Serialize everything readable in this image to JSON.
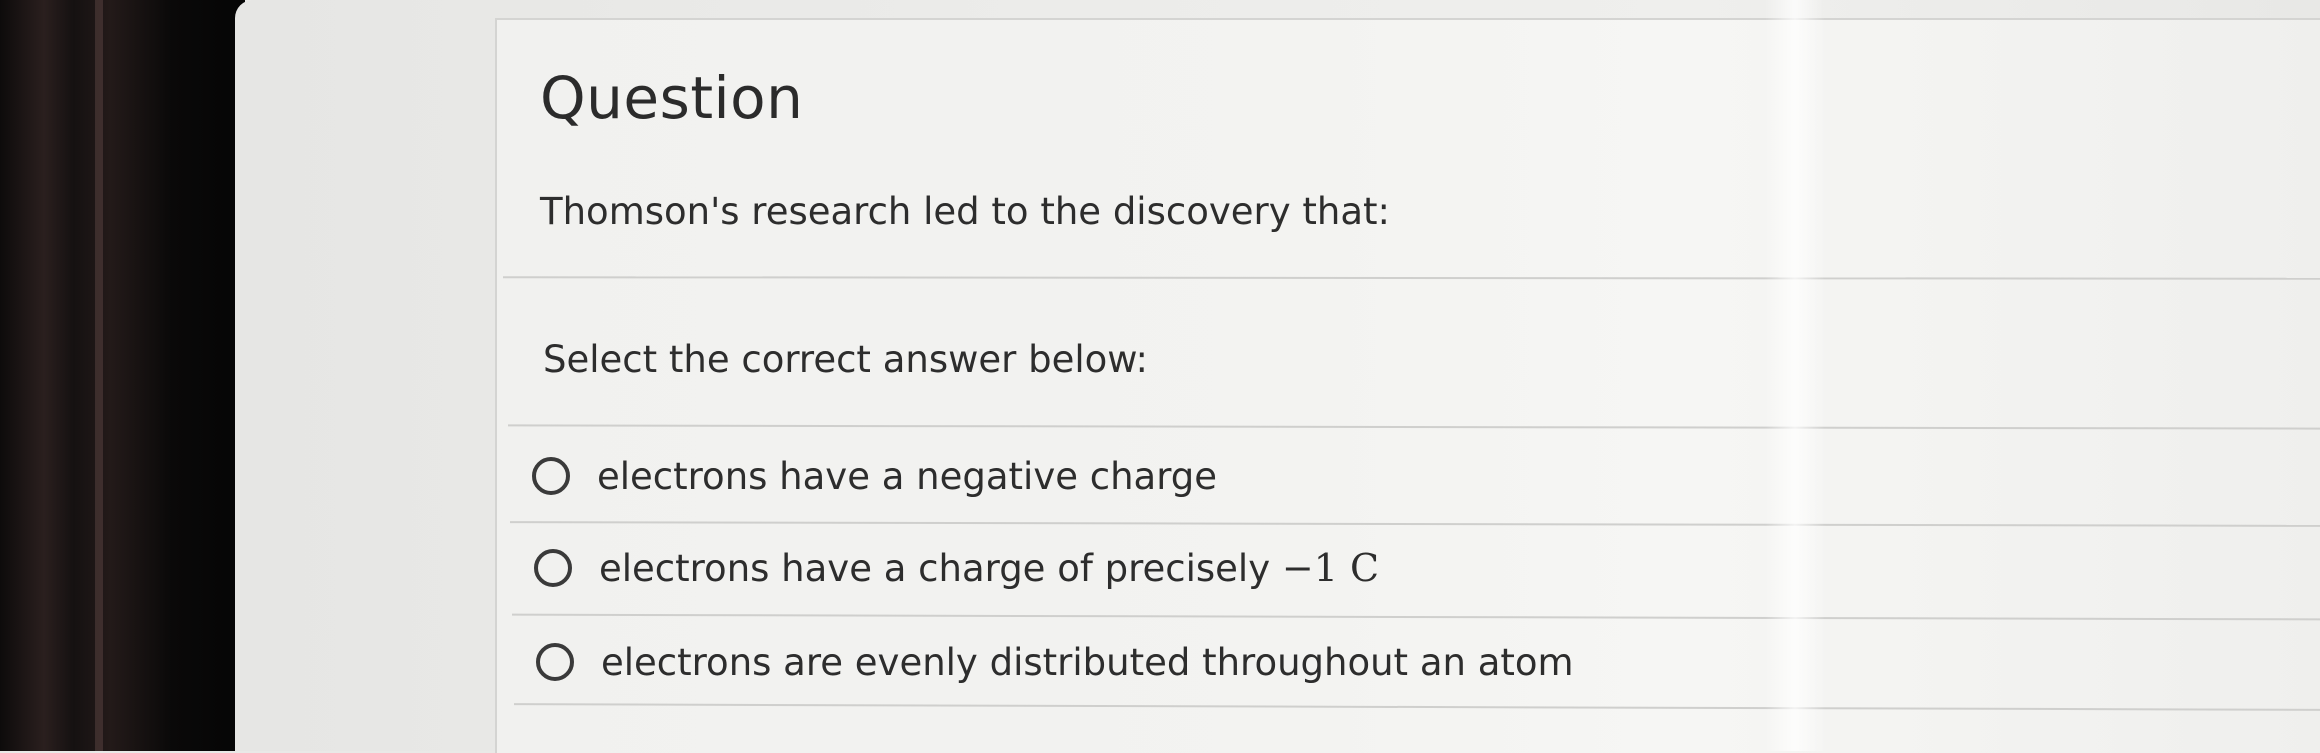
{
  "question": {
    "title": "Question",
    "text": "Thomson's research led to the discovery that:",
    "prompt": "Select the correct answer below:"
  },
  "options": [
    {
      "label": "electrons have a negative charge"
    },
    {
      "label": "electrons have a charge of precisely ",
      "math": "−1 C"
    },
    {
      "label": "electrons are evenly distributed throughout an atom"
    }
  ],
  "colors": {
    "text": "#2d2d2d",
    "divider": "#cfcfcd",
    "card": "#f3f3f1",
    "bezel": "#0d0b0b"
  }
}
